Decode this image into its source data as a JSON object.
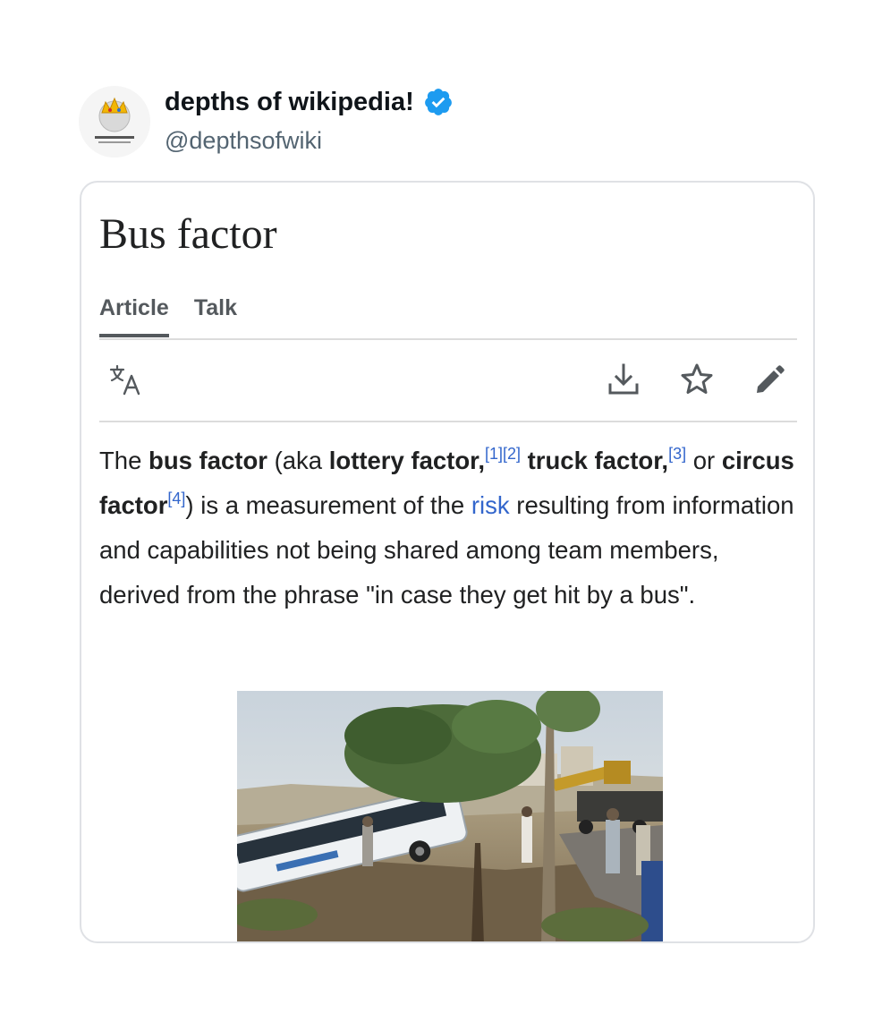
{
  "tweet": {
    "display_name": "depths of wikipedia!",
    "handle": "@depthsofwiki",
    "avatar_icon": "wikipedia-globe-crown-icon",
    "verified_icon": "verified-badge-icon",
    "verified_color": "#1d9bf0"
  },
  "article": {
    "title": "Bus factor",
    "tabs": [
      {
        "label": "Article",
        "active": true
      },
      {
        "label": "Talk",
        "active": false
      }
    ],
    "toolbar": {
      "language_icon": "translate-icon",
      "download_icon": "download-icon",
      "watch_icon": "star-icon",
      "edit_icon": "pencil-icon"
    },
    "paragraph": {
      "t1": "The ",
      "b1": "bus factor",
      "t2": " (aka ",
      "b2": "lottery factor,",
      "ref1": "[1]",
      "ref2": "[2]",
      "t3": " ",
      "b3": "truck factor,",
      "ref3": "[3]",
      "t4": " or ",
      "b4": "circus factor",
      "ref4": "[4]",
      "t5": ") is a measurement of the ",
      "link": "risk",
      "t6": " resulting from information and capabilities not being shared among team members, derived from the phrase \"in case they get hit by a bus\"."
    },
    "image_description_icon": "crashed-bus-photo",
    "link_color": "#3366cc"
  }
}
